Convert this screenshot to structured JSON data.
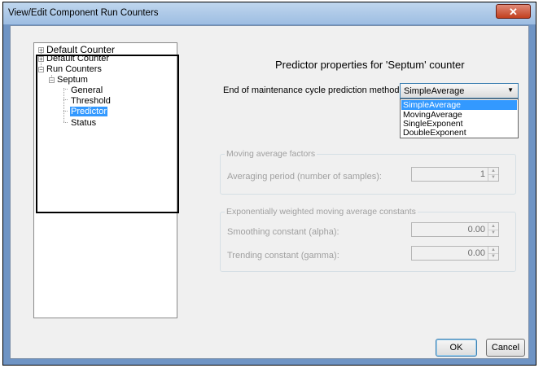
{
  "window": {
    "title": "View/Edit Component Run Counters",
    "close_glyph": "✕"
  },
  "tree": {
    "items": [
      {
        "label": "Default Counter",
        "expander": "+"
      },
      {
        "label": "Default Counter",
        "expander": "+"
      },
      {
        "label": "Run Counters",
        "expander": "−"
      },
      {
        "label": "Septum",
        "expander": "−"
      },
      {
        "label": "General"
      },
      {
        "label": "Threshold"
      },
      {
        "label": "Predictor",
        "selected": true
      },
      {
        "label": "Status"
      }
    ]
  },
  "panel": {
    "heading": "Predictor properties for 'Septum' counter",
    "method_label": "End of maintenance cycle prediction method:",
    "method_selected": "SimpleAverage",
    "method_options": [
      "SimpleAverage",
      "MovingAverage",
      "SingleExponent",
      "DoubleExponent"
    ],
    "moving_group": {
      "title": "Moving average factors",
      "period_label": "Averaging period (number of samples):",
      "period_value": "1"
    },
    "ewma_group": {
      "title": "Exponentially weighted moving average constants",
      "alpha_label": "Smoothing constant (alpha):",
      "alpha_value": "0.00",
      "gamma_label": "Trending constant (gamma):",
      "gamma_value": "0.00"
    }
  },
  "buttons": {
    "ok": "OK",
    "cancel": "Cancel"
  },
  "colors": {
    "selection": "#3399ff",
    "title_gradient": "#bfd6ee",
    "close_red": "#c2401f"
  }
}
